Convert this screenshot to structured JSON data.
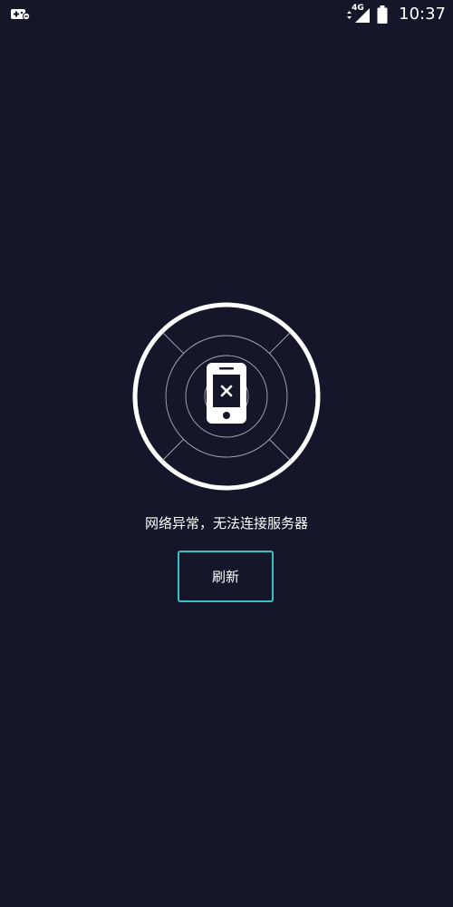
{
  "status_bar": {
    "time": "10:37",
    "network_type": "4G",
    "icons": [
      "game-notification-icon",
      "data-arrows-icon",
      "signal-icon",
      "battery-icon"
    ]
  },
  "error": {
    "icon": "phone-offline-icon",
    "message": "网络异常，无法连接服务器",
    "refresh_label": "刷新"
  },
  "colors": {
    "background": "#15162a",
    "button_border": "#3bc1c4",
    "foreground": "#ffffff"
  }
}
